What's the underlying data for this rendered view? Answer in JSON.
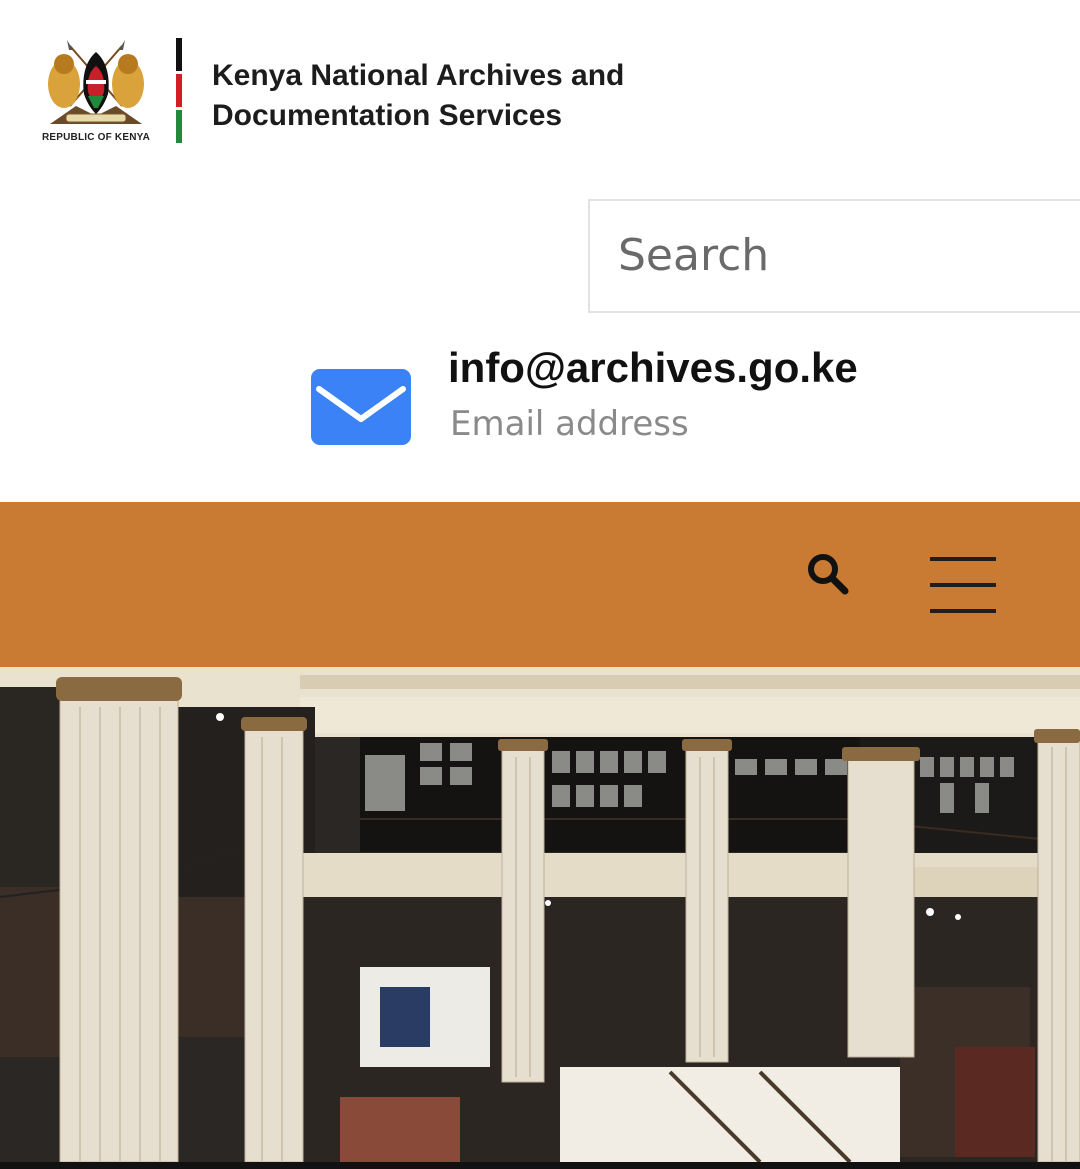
{
  "header": {
    "logo_caption": "REPUBLIC OF KENYA",
    "org_name_line1": "Kenya National Archives and",
    "org_name_line2": "Documentation Services",
    "flag_colors": [
      "#111111",
      "#d21f26",
      "#1f8a3b"
    ]
  },
  "search": {
    "placeholder": "Search"
  },
  "contact": {
    "email": "info@archives.go.ke",
    "label": "Email address",
    "icon": "envelope-icon",
    "icon_color": "#3b82f6"
  },
  "navbar": {
    "background": "#c97a33",
    "search_icon": "search-icon",
    "menu_icon": "hamburger-menu-icon"
  },
  "hero": {
    "description_icon": "museum-hall-photo"
  }
}
